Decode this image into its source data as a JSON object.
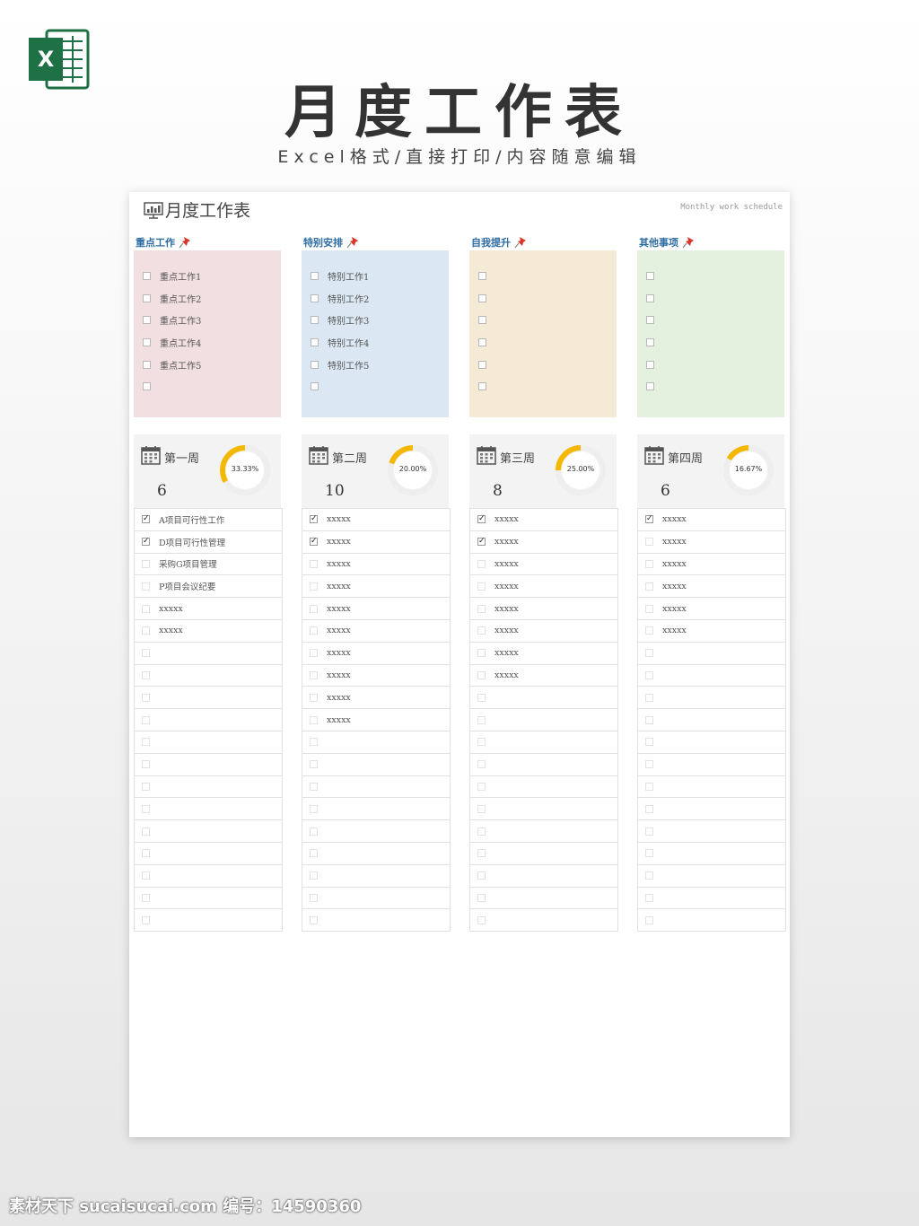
{
  "hero": {
    "title": "月度工作表",
    "subtitle": "Excel格式/直接打印/内容随意编辑",
    "icon": "excel-icon"
  },
  "sheet": {
    "title": "月度工作表",
    "subtitle_en": "Monthly work schedule"
  },
  "colors": {
    "cat0": "#f2dfe1",
    "cat1": "#dbe7f2",
    "cat2": "#f5ead6",
    "cat3": "#e4f1df",
    "accent": "#f5b800",
    "label": "#2e6da4",
    "pin": "#d9362b"
  },
  "categories": [
    {
      "label": "重点工作",
      "items": [
        "重点工作1",
        "重点工作2",
        "重点工作3",
        "重点工作4",
        "重点工作5",
        ""
      ]
    },
    {
      "label": "特别安排",
      "items": [
        "特别工作1",
        "特别工作2",
        "特别工作3",
        "特别工作4",
        "特别工作5",
        ""
      ]
    },
    {
      "label": "自我提升",
      "items": [
        "",
        "",
        "",
        "",
        "",
        ""
      ]
    },
    {
      "label": "其他事项",
      "items": [
        "",
        "",
        "",
        "",
        "",
        ""
      ]
    }
  ],
  "weeks": [
    {
      "label": "第一周",
      "count": "6",
      "percent_text": "33.33%",
      "percent": 0.3333,
      "tasks": [
        {
          "text": "A项目可行性工作",
          "done": true
        },
        {
          "text": "D项目可行性管理",
          "done": true
        },
        {
          "text": "采购G项目管理",
          "done": false
        },
        {
          "text": "P项目会议纪要",
          "done": false
        },
        {
          "text": "xxxxx",
          "done": false
        },
        {
          "text": "xxxxx",
          "done": false
        }
      ]
    },
    {
      "label": "第二周",
      "count": "10",
      "percent_text": "20.00%",
      "percent": 0.2,
      "tasks": [
        {
          "text": "xxxxx",
          "done": true
        },
        {
          "text": "xxxxx",
          "done": true
        },
        {
          "text": "xxxxx",
          "done": false
        },
        {
          "text": "xxxxx",
          "done": false
        },
        {
          "text": "xxxxx",
          "done": false
        },
        {
          "text": "xxxxx",
          "done": false
        },
        {
          "text": "xxxxx",
          "done": false
        },
        {
          "text": "xxxxx",
          "done": false
        },
        {
          "text": "xxxxx",
          "done": false
        },
        {
          "text": "xxxxx",
          "done": false
        }
      ]
    },
    {
      "label": "第三周",
      "count": "8",
      "percent_text": "25.00%",
      "percent": 0.25,
      "tasks": [
        {
          "text": "xxxxx",
          "done": true
        },
        {
          "text": "xxxxx",
          "done": true
        },
        {
          "text": "xxxxx",
          "done": false
        },
        {
          "text": "xxxxx",
          "done": false
        },
        {
          "text": "xxxxx",
          "done": false
        },
        {
          "text": "xxxxx",
          "done": false
        },
        {
          "text": "xxxxx",
          "done": false
        },
        {
          "text": "xxxxx",
          "done": false
        }
      ]
    },
    {
      "label": "第四周",
      "count": "6",
      "percent_text": "16.67%",
      "percent": 0.1667,
      "tasks": [
        {
          "text": "xxxxx",
          "done": true
        },
        {
          "text": "xxxxx",
          "done": false
        },
        {
          "text": "xxxxx",
          "done": false
        },
        {
          "text": "xxxxx",
          "done": false
        },
        {
          "text": "xxxxx",
          "done": false
        },
        {
          "text": "xxxxx",
          "done": false
        }
      ]
    }
  ],
  "watermark": "素材天下 sucaisucai.com  编号：14590360"
}
